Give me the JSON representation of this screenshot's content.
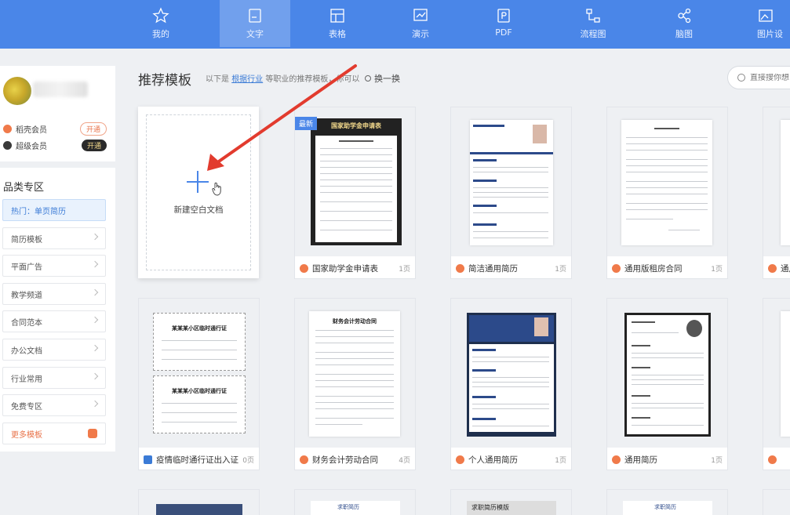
{
  "nav": {
    "items": [
      {
        "label": "我的",
        "icon": "star-icon"
      },
      {
        "label": "文字",
        "icon": "document-icon",
        "active": true
      },
      {
        "label": "表格",
        "icon": "table-icon"
      },
      {
        "label": "演示",
        "icon": "presentation-icon"
      },
      {
        "label": "PDF",
        "icon": "pdf-icon"
      },
      {
        "label": "流程图",
        "icon": "flowchart-icon"
      },
      {
        "label": "脑图",
        "icon": "mindmap-icon"
      },
      {
        "label": "图片设",
        "icon": "image-design-icon"
      }
    ]
  },
  "profile": {
    "member1_label": "稻壳会员",
    "member1_btn": "开通",
    "member2_label": "超级会员",
    "member2_btn": "开通"
  },
  "categories": {
    "title": "品类专区",
    "hot": "热门：单页简历",
    "items": [
      "简历模板",
      "平面广告",
      "教学频道",
      "合同范本",
      "办公文档",
      "行业常用",
      "免费专区"
    ],
    "more": "更多模板"
  },
  "header": {
    "title": "推荐模板",
    "sub_prefix": "以下是",
    "sub_link": "根据行业",
    "sub_suffix": "等职业的推荐模板，你可以",
    "refresh": "换一换",
    "search_placeholder": "直接搜你想"
  },
  "new_doc": {
    "label": "新建空白文档"
  },
  "cards": [
    {
      "name": "国家助学金申请表",
      "pages": "1页",
      "badge": "最新",
      "heading": "国家助学金申请表"
    },
    {
      "name": "简洁通用简历",
      "pages": "1页"
    },
    {
      "name": "通用版租房合同",
      "pages": "1页"
    },
    {
      "name": "通用",
      "pages": ""
    },
    {
      "name": "疫情临时通行证出入证",
      "pages": "0页",
      "free": true,
      "pass_title": "某某某小区临时通行证"
    },
    {
      "name": "财务会计劳动合同",
      "pages": "4页",
      "doc_title": "财务会计劳动合同"
    },
    {
      "name": "个人通用简历",
      "pages": "1页"
    },
    {
      "name": "通用简历",
      "pages": "1页"
    },
    {
      "name": "",
      "pages": ""
    }
  ],
  "bottom_row": [
    {
      "text": ""
    },
    {
      "text": "求职简历"
    },
    {
      "text": "求职简历模版"
    },
    {
      "text": "求职简历"
    },
    {
      "text": ""
    }
  ],
  "colors": {
    "nav": "#4a86e8",
    "accent": "#e8734a",
    "link": "#3b7bd6"
  }
}
